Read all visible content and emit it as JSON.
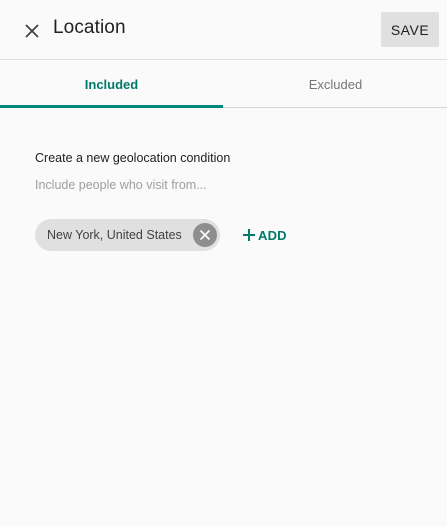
{
  "header": {
    "close_icon": "close-icon",
    "title": "Location",
    "save_label": "SAVE"
  },
  "tabs": [
    {
      "label": "Included",
      "active": true
    },
    {
      "label": "Excluded",
      "active": false
    }
  ],
  "condition": {
    "heading": "Create a new geolocation condition",
    "subheading": "Include people who visit from..."
  },
  "chips": [
    {
      "label": "New York, United States",
      "remove_icon": "cancel-circle-icon"
    }
  ],
  "add": {
    "icon": "plus-icon",
    "label": "ADD"
  },
  "colors": {
    "accent": "#00897b",
    "accent_text": "#00796b",
    "background": "#fafafa",
    "chip_background": "#e0e0e0",
    "save_background": "#e0e0e0"
  }
}
